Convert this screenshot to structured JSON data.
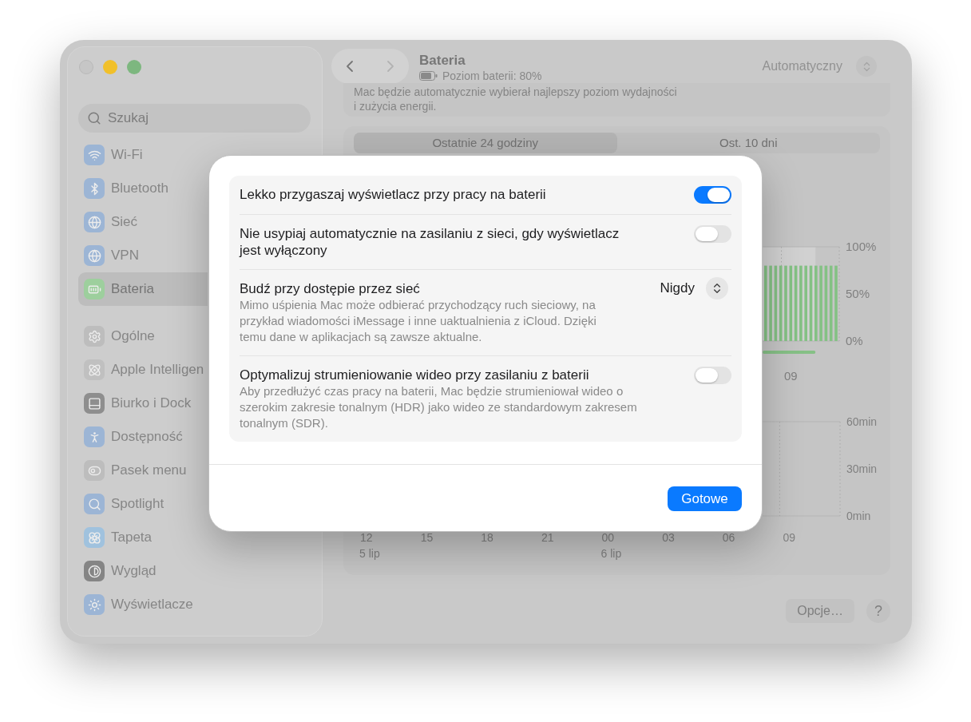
{
  "window": {
    "controls": [
      {
        "kind": "close",
        "disabled": true
      },
      {
        "kind": "minimize",
        "disabled": false
      },
      {
        "kind": "zoom",
        "disabled": false
      }
    ]
  },
  "sidebar": {
    "search": {
      "placeholder": "Szukaj"
    },
    "groups": [
      {
        "items": [
          {
            "label": "Wi-Fi",
            "selected": false
          },
          {
            "label": "Bluetooth",
            "selected": false
          },
          {
            "label": "Sieć",
            "selected": false
          },
          {
            "label": "VPN",
            "selected": false
          },
          {
            "label": "Bateria",
            "selected": true
          }
        ]
      },
      {
        "items": [
          {
            "label": "Ogólne",
            "selected": false
          },
          {
            "label": "Apple Intelligen",
            "selected": false
          },
          {
            "label": "Biurko i Dock",
            "selected": false
          },
          {
            "label": "Dostępność",
            "selected": false
          },
          {
            "label": "Pasek menu",
            "selected": false
          },
          {
            "label": "Spotlight",
            "selected": false
          },
          {
            "label": "Tapeta",
            "selected": false
          },
          {
            "label": "Wygląd",
            "selected": false
          },
          {
            "label": "Wyświetlacze",
            "selected": false
          }
        ]
      }
    ]
  },
  "toolbar": {
    "navigation": [
      {
        "kind": "back",
        "disabled": false
      },
      {
        "kind": "forward",
        "disabled": true
      }
    ],
    "title": "Bateria",
    "subtitle": "Poziom baterii: 80%"
  },
  "energy_mode": {
    "value": "Automatyczny",
    "description": "Mac będzie automatycznie wybierał najlepszy poziom wydajności\ni zużycia energii."
  },
  "usage": {
    "tabs": [
      {
        "label": "Ostatnie 24 godziny",
        "selected": true
      },
      {
        "label": "Ost. 10 dni",
        "selected": false
      }
    ],
    "battery_chart": {
      "chart_data": {
        "type": "bar",
        "categories": [
          null,
          null,
          null,
          null,
          null,
          "09",
          null,
          null,
          null,
          null,
          null,
          null,
          null,
          null,
          null
        ],
        "values": [
          80,
          80,
          80,
          80,
          80,
          80,
          80,
          80,
          80,
          80,
          80,
          80,
          80,
          80,
          80
        ],
        "ylim": [
          0,
          100
        ],
        "yticks": [
          {
            "value": 0,
            "label": "0%"
          },
          {
            "value": 50,
            "label": "50%"
          },
          {
            "value": 100,
            "label": "100%"
          }
        ]
      }
    },
    "screen_chart": {
      "chart_data": {
        "type": "bar",
        "categories": [
          "12",
          null,
          null,
          "15",
          null,
          null,
          "18",
          null,
          null,
          "21",
          null,
          null,
          "00",
          null,
          null,
          "03",
          null,
          null,
          "06",
          null,
          null,
          "09",
          null,
          null
        ],
        "ylim": [
          0,
          60
        ],
        "yticks": [
          {
            "value": 0,
            "label": "0min"
          },
          {
            "value": 30,
            "label": "30min"
          },
          {
            "value": 60,
            "label": "60min"
          }
        ],
        "annotations": [
          "5 lip",
          "6 lip"
        ]
      }
    }
  },
  "footer": {
    "buttons": [
      {
        "kind": "text",
        "label": "Opcje…"
      },
      {
        "kind": "help",
        "label": "?"
      }
    ]
  },
  "dialog": {
    "rows": [
      {
        "kind": "toggle",
        "title": "Lekko przygaszaj wyświetlacz przy pracy na baterii",
        "on": true
      },
      {
        "kind": "toggle",
        "title": "Nie usypiaj automatycznie na zasilaniu z sieci, gdy wyświetlacz jest wyłączony",
        "on": false
      },
      {
        "kind": "popup",
        "title": "Budź przy dostępie przez sieć",
        "description": "Mimo uśpienia Mac może odbierać przychodzący ruch sieciowy, na przykład wiadomości iMessage i inne uaktualnienia z iCloud. Dzięki temu dane w aplikacjach są zawsze aktualne.",
        "value": "Nigdy"
      },
      {
        "kind": "toggle",
        "title": "Optymalizuj strumieniowanie wideo przy zasilaniu z baterii",
        "description": "Aby przedłużyć czas pracy na baterii, Mac będzie strumieniował wideo o szerokim zakresie tonalnym (HDR) jako wideo ze standardowym zakresem tonalnym (SDR).",
        "on": false
      }
    ],
    "buttons": [
      {
        "kind": "primary",
        "label": "Gotowe"
      }
    ]
  }
}
